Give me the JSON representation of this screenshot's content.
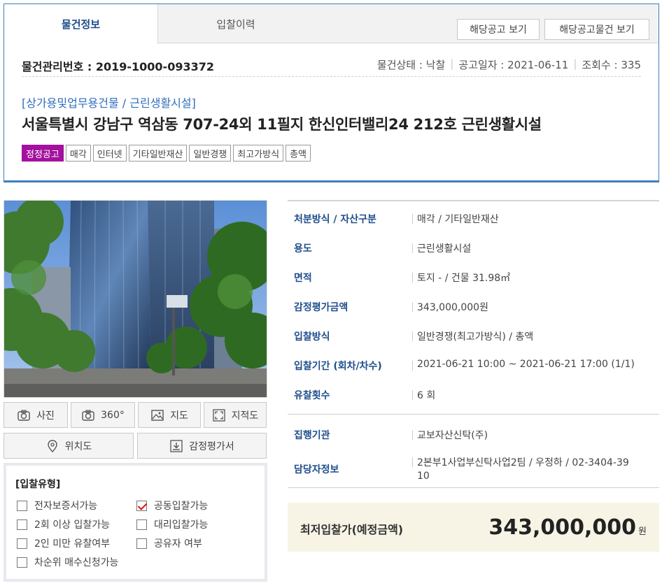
{
  "tabs": [
    {
      "label": "물건정보",
      "active": true
    },
    {
      "label": "입찰이력",
      "active": false
    }
  ],
  "header_buttons": {
    "notice": "해당공고 보기",
    "notice_items": "해당공고물건 보기"
  },
  "item": {
    "mgmt_no_label": "물건관리번호 : 2019-1000-093372",
    "status": "물건상태 : 낙찰",
    "notice_date": "공고일자 : 2021-06-11",
    "views": "조회수 : 335",
    "category": "[상가용및업무용건물 / 근린생활시설]",
    "address": "서울특별시 강남구 역삼동 707-24외 11필지 한신인터밸리24 212호 근린생활시설",
    "tags": [
      "정정공고",
      "매각",
      "인터넷",
      "기타일반재산",
      "일반경쟁",
      "최고가방식",
      "총액"
    ]
  },
  "media_buttons": {
    "photo": "사진",
    "view360": "360°",
    "map": "지도",
    "cadastral": "지적도",
    "location": "위치도",
    "appraisal": "감정평가서"
  },
  "bid_type": {
    "title": "[입찰유형]",
    "options": [
      {
        "label": "전자보증서가능",
        "checked": false
      },
      {
        "label": "공동입찰가능",
        "checked": true
      },
      {
        "label": "2회 이상 입찰가능",
        "checked": false
      },
      {
        "label": "대리입찰가능",
        "checked": false
      },
      {
        "label": "2인 미만 유찰여부",
        "checked": false
      },
      {
        "label": "공유자 여부",
        "checked": false
      },
      {
        "label": "차순위 매수신청가능",
        "checked": false
      }
    ]
  },
  "info": {
    "disposal_label": "처분방식 / 자산구분",
    "disposal_value": "매각 / 기타일반재산",
    "usage_label": "용도",
    "usage_value": "근린생활시설",
    "area_label": "면적",
    "area_value": "토지 - / 건물 31.98㎡",
    "appraisal_label": "감정평가금액",
    "appraisal_value": "343,000,000원",
    "bid_method_label": "입찰방식",
    "bid_method_value": "일반경쟁(최고가방식) / 총액",
    "bid_period_label": "입찰기간 (회차/차수)",
    "bid_period_value": "2021-06-21 10:00 ~ 2021-06-21 17:00 (1/1)",
    "failed_count_label": "유찰횟수",
    "failed_count_value": "6 회",
    "executor_label": "집행기관",
    "executor_value": "교보자산신탁(주)",
    "contact_label": "담당자정보",
    "contact_value_line1": "2본부1사업부신탁사업2팀 / 우정하 / 02-3404-39",
    "contact_value_line2": "10"
  },
  "min_bid": {
    "label": "최저입찰가(예정금액)",
    "amount": "343,000,000",
    "unit": "원"
  },
  "colors": {
    "accent_blue": "#3f7fbf",
    "label_blue": "#1f4e8c",
    "tag_magenta": "#a3119e",
    "min_bid_bg": "#f7f4e6"
  }
}
